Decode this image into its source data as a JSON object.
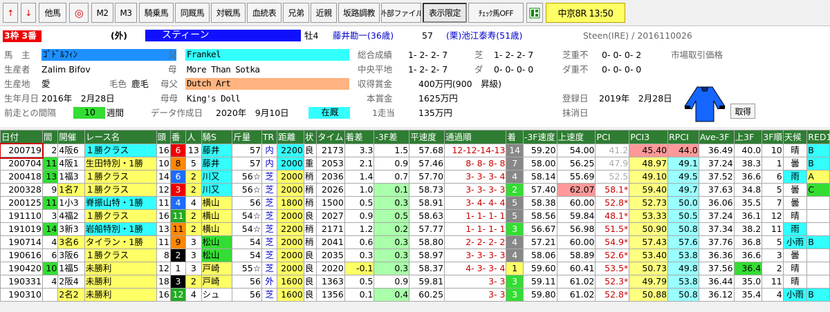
{
  "toolbar": {
    "up_arrow": "↑",
    "down_arrow": "↓",
    "buttons": [
      "他馬",
      "◎",
      "M2",
      "M3",
      "騎乗馬",
      "同厩馬",
      "対戦馬",
      "血統表",
      "兄弟",
      "近親",
      "坂路調教",
      "外部ファイル",
      "表示限定",
      "ﾁｪｯｸ馬OFF"
    ],
    "race_label": "中京8R 13:50"
  },
  "horse": {
    "frame": "3枠 3番",
    "origin": "(外)",
    "name": "スティーン",
    "sex_age": "牡4",
    "jockey": "藤井勘一(36歳)",
    "weight": "57",
    "trainer": "(栗)池江泰寿(51歳)",
    "eng_name": "Steen(IRE) / 2016110026",
    "owner_label": "馬　主",
    "owner": "ｺﾞﾄﾞﾙﾌｨﾝ",
    "breeder_label": "生産者",
    "breeder": "Zalim Bifov",
    "birthplace_label": "生産地",
    "birthplace": "愛",
    "coat_label": "毛色",
    "coat": "鹿毛",
    "birthdate_label": "生年月日",
    "birthdate": "2016年　2月28日",
    "interval_label": "前走との間隔",
    "interval": "10",
    "interval_unit": "週間",
    "sire_label": "父",
    "sire": "Frankel",
    "dam_label": "母",
    "dam": "More Than Sotka",
    "damsire_label": "母父",
    "damsire": "Dutch Art",
    "grandam_label": "母母",
    "grandam": "King's Doll",
    "datadate_label": "データ作成日",
    "datadate": "2020年　9月10日",
    "status": "在厩",
    "overall_label": "総合成績",
    "overall": "1- 2- 2- 7",
    "central_label": "中央平地",
    "central": "1- 2- 2- 7",
    "prize_label": "収得賞金",
    "prize": "400万円(900　昇級)",
    "main_prize_label": "本賞金",
    "main_prize": "1625万円",
    "first_label": "1走当",
    "first": "135万円",
    "turf_label": "芝",
    "turf": "1- 2- 2- 7",
    "dirt_label": "ダ",
    "dirt": "0- 0- 0- 0",
    "turf_heavy_label": "芝重不",
    "turf_heavy": "0- 0- 0- 2",
    "dirt_heavy_label": "ダ重不",
    "dirt_heavy": "0- 0- 0- 0",
    "market_label": "市場取引価格",
    "reg_label": "登録日",
    "reg": "2019年　2月28日",
    "cancel_label": "抹消日",
    "get_button": "取得"
  },
  "table": {
    "headers": [
      "日付",
      "間",
      "開催",
      "レース名",
      "頭",
      "番",
      "人",
      "騎S",
      "斤量",
      "TR",
      "距離",
      "状",
      "タイム",
      "着差",
      "-3F差",
      "平速度",
      "通過順",
      "着",
      "-3F速度",
      "上速度",
      "PCI",
      "PCI3",
      "RPCI",
      "Ave-3F",
      "上3F",
      "3F順",
      "天候",
      "RED1"
    ],
    "rows": [
      [
        "200719",
        "2",
        "4阪6",
        "１勝クラス",
        "16",
        "6",
        "13",
        "藤井",
        "57",
        "内",
        "2200",
        "良",
        "2173",
        "3.3",
        "1.5",
        "57.68",
        "12-12-14-13",
        "14",
        "59.20",
        "54.00",
        "41.2",
        "45.40",
        "44.0",
        "36.49",
        "40.0",
        "10",
        "晴",
        "B"
      ],
      [
        "200704",
        "11",
        "4阪1",
        "生田特別・1勝",
        "10",
        "8",
        "5",
        "藤井",
        "57",
        "内",
        "2000",
        "重",
        "2053",
        "2.1",
        "0.9",
        "57.46",
        "8- 8- 8- 8",
        "7",
        "58.00",
        "56.25",
        "47.9",
        "48.97",
        "49.1",
        "37.24",
        "38.3",
        "1",
        "曇",
        "B"
      ],
      [
        "200418",
        "13",
        "1福3",
        "１勝クラス",
        "14",
        "6",
        "2",
        "川又",
        "56☆",
        "芝",
        "2000",
        "稍",
        "2036",
        "1.4",
        "0.7",
        "57.70",
        "3- 3- 3- 4",
        "4",
        "58.14",
        "55.69",
        "52.5",
        "49.10",
        "49.5",
        "37.52",
        "36.6",
        "6",
        "雨",
        "A"
      ],
      [
        "200328",
        "9",
        "1名7",
        "１勝クラス",
        "12",
        "3",
        "2",
        "川又",
        "56☆",
        "芝",
        "2000",
        "稍",
        "2026",
        "1.0",
        "0.1",
        "58.73",
        "3- 3- 3- 3",
        "2",
        "57.40",
        "62.07",
        "58.1*",
        "59.40",
        "49.7",
        "37.63",
        "34.8",
        "5",
        "曇",
        "C"
      ],
      [
        "200125",
        "11",
        "1小3",
        "脊振山特・1勝",
        "11",
        "4",
        "4",
        "横山",
        "56",
        "芝",
        "1800",
        "稍",
        "1500",
        "0.5",
        "0.3",
        "58.91",
        "3- 4- 4- 4",
        "5",
        "58.38",
        "60.00",
        "52.8*",
        "52.73",
        "50.0",
        "36.06",
        "35.5",
        "7",
        "曇",
        ""
      ],
      [
        "191110",
        "3",
        "4福2",
        "１勝クラス",
        "16",
        "11",
        "2",
        "横山",
        "54☆",
        "芝",
        "2000",
        "良",
        "2027",
        "0.9",
        "0.5",
        "58.63",
        "1- 1- 1- 1",
        "5",
        "58.56",
        "59.84",
        "48.1*",
        "53.33",
        "50.5",
        "37.24",
        "36.1",
        "12",
        "晴",
        ""
      ],
      [
        "191019",
        "14",
        "3新3",
        "岩船特別・1勝",
        "13",
        "11",
        "2",
        "横山",
        "54☆",
        "芝",
        "2200",
        "稍",
        "2171",
        "1.2",
        "0.2",
        "57.77",
        "1- 1- 1- 1",
        "3",
        "56.67",
        "56.98",
        "51.5*",
        "50.90",
        "50.8",
        "37.34",
        "38.2",
        "11",
        "雨",
        ""
      ],
      [
        "190714",
        "4",
        "3名6",
        "タイラン・1勝",
        "11",
        "9",
        "3",
        "松山",
        "54",
        "芝",
        "2000",
        "稍",
        "2041",
        "0.6",
        "0.3",
        "58.80",
        "2- 2- 2- 2",
        "4",
        "57.21",
        "60.00",
        "54.9*",
        "57.43",
        "57.6",
        "37.76",
        "36.8",
        "5",
        "小雨",
        "B"
      ],
      [
        "190616",
        "6",
        "3阪6",
        "１勝クラス",
        "8",
        "2",
        "3",
        "松山",
        "54",
        "芝",
        "2000",
        "良",
        "2035",
        "0.3",
        "0.3",
        "58.97",
        "3- 3- 3- 3",
        "4",
        "58.06",
        "58.89",
        "52.6*",
        "53.40",
        "53.8",
        "36.36",
        "36.6",
        "3",
        "曇",
        ""
      ],
      [
        "190420",
        "10",
        "1福5",
        "未勝利",
        "12",
        "1",
        "3",
        "戸崎",
        "55☆",
        "芝",
        "2000",
        "良",
        "2020",
        "-0.1",
        "0.3",
        "58.37",
        "4- 3- 3- 4",
        "1",
        "59.60",
        "60.41",
        "53.5*",
        "50.73",
        "49.8",
        "37.56",
        "36.4",
        "2",
        "晴",
        ""
      ],
      [
        "190331",
        "4",
        "2阪4",
        "未勝利",
        "18",
        "3",
        "2",
        "戸崎",
        "56",
        "外",
        "1600",
        "良",
        "1363",
        "0.5",
        "0.9",
        "59.81",
        "3- 3",
        "3",
        "59.11",
        "61.02",
        "52.3*",
        "49.79",
        "53.8",
        "36.44",
        "35.0",
        "11",
        "晴",
        ""
      ],
      [
        "190310",
        "",
        "2名2",
        "未勝利",
        "16",
        "12",
        "4",
        "シュ",
        "56",
        "芝",
        "1600",
        "良",
        "1356",
        "0.1",
        "0.4",
        "60.25",
        "3- 3",
        "3",
        "59.80",
        "61.02",
        "52.8*",
        "50.88",
        "50.8",
        "36.12",
        "35.4",
        "4",
        "小雨",
        "B"
      ]
    ]
  },
  "colors": {
    "header_green": "#2e7d32",
    "race_yellow": "#ffff66",
    "pci_pink": "#ff9999",
    "pci3_yellow": "#ffff80",
    "rpci_cyan": "#99ffff"
  }
}
